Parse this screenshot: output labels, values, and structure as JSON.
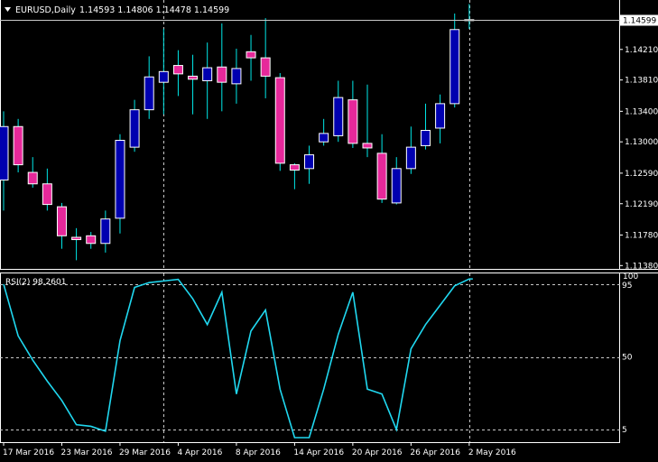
{
  "header": {
    "symbol_label": "EURUSD,Daily",
    "ohlc_label": "1.14593 1.14806 1.14478 1.14599",
    "menu_icon": "triangle-down-icon"
  },
  "rsi": {
    "label": "RSI(2) 98.2601",
    "value": 98.2601,
    "levels": [
      95,
      50,
      5
    ],
    "max_label": "100"
  },
  "current_price_label": "1.14599",
  "colors": {
    "background": "#000000",
    "bull_body": "#0000b0",
    "bear_body": "#e6289a",
    "wick": "#00e8e8",
    "candle_outline": "#ffffff",
    "rsi_line": "#20d8f0",
    "grid": "#c8c8c8",
    "price_line": "#c8c8c8"
  },
  "chart_data": [
    {
      "type": "candlestick",
      "title": "EURUSD,Daily",
      "price_ticks": [
        "1.14210",
        "1.13810",
        "1.13400",
        "1.13000",
        "1.12590",
        "1.12190",
        "1.11780",
        "1.11380"
      ],
      "price_range": [
        1.1136,
        1.1481
      ],
      "date_ticks": [
        "17 Mar 2016",
        "23 Mar 2016",
        "29 Mar 2016",
        "4 Apr 2016",
        "8 Apr 2016",
        "14 Apr 2016",
        "20 Apr 2016",
        "26 Apr 2016",
        "2 May 2016"
      ],
      "candles": [
        {
          "o": 1.125,
          "h": 1.134,
          "l": 1.121,
          "c": 1.132
        },
        {
          "o": 1.132,
          "h": 1.133,
          "l": 1.126,
          "c": 1.127
        },
        {
          "o": 1.126,
          "h": 1.128,
          "l": 1.124,
          "c": 1.1245
        },
        {
          "o": 1.1245,
          "h": 1.1265,
          "l": 1.121,
          "c": 1.1218
        },
        {
          "o": 1.1215,
          "h": 1.122,
          "l": 1.116,
          "c": 1.1177
        },
        {
          "o": 1.1175,
          "h": 1.1187,
          "l": 1.1145,
          "c": 1.1172
        },
        {
          "o": 1.1177,
          "h": 1.1182,
          "l": 1.116,
          "c": 1.1167
        },
        {
          "o": 1.1167,
          "h": 1.121,
          "l": 1.1155,
          "c": 1.1199
        },
        {
          "o": 1.12,
          "h": 1.131,
          "l": 1.118,
          "c": 1.1302
        },
        {
          "o": 1.1293,
          "h": 1.1355,
          "l": 1.1287,
          "c": 1.1342
        },
        {
          "o": 1.1342,
          "h": 1.1412,
          "l": 1.133,
          "c": 1.1385
        },
        {
          "o": 1.1378,
          "h": 1.1448,
          "l": 1.1336,
          "c": 1.1392
        },
        {
          "o": 1.14,
          "h": 1.142,
          "l": 1.136,
          "c": 1.1389
        },
        {
          "o": 1.1386,
          "h": 1.1414,
          "l": 1.1336,
          "c": 1.1382
        },
        {
          "o": 1.138,
          "h": 1.143,
          "l": 1.133,
          "c": 1.1397
        },
        {
          "o": 1.1398,
          "h": 1.1455,
          "l": 1.134,
          "c": 1.1378
        },
        {
          "o": 1.1376,
          "h": 1.1422,
          "l": 1.135,
          "c": 1.1396
        },
        {
          "o": 1.1418,
          "h": 1.144,
          "l": 1.138,
          "c": 1.141
        },
        {
          "o": 1.141,
          "h": 1.1462,
          "l": 1.1357,
          "c": 1.1386
        },
        {
          "o": 1.1384,
          "h": 1.139,
          "l": 1.1262,
          "c": 1.1272
        },
        {
          "o": 1.127,
          "h": 1.1272,
          "l": 1.1238,
          "c": 1.1263
        },
        {
          "o": 1.1265,
          "h": 1.1295,
          "l": 1.1245,
          "c": 1.1283
        },
        {
          "o": 1.13,
          "h": 1.133,
          "l": 1.1295,
          "c": 1.1311
        },
        {
          "o": 1.1308,
          "h": 1.138,
          "l": 1.13,
          "c": 1.1358
        },
        {
          "o": 1.1355,
          "h": 1.138,
          "l": 1.1292,
          "c": 1.1298
        },
        {
          "o": 1.1298,
          "h": 1.1375,
          "l": 1.128,
          "c": 1.1292
        },
        {
          "o": 1.1285,
          "h": 1.131,
          "l": 1.122,
          "c": 1.1225
        },
        {
          "o": 1.122,
          "h": 1.128,
          "l": 1.1218,
          "c": 1.1265
        },
        {
          "o": 1.1265,
          "h": 1.132,
          "l": 1.1258,
          "c": 1.1293
        },
        {
          "o": 1.1295,
          "h": 1.135,
          "l": 1.129,
          "c": 1.1315
        },
        {
          "o": 1.1318,
          "h": 1.1362,
          "l": 1.1298,
          "c": 1.135
        },
        {
          "o": 1.135,
          "h": 1.1468,
          "l": 1.1345,
          "c": 1.1447
        },
        {
          "o": 1.14593,
          "h": 1.14806,
          "l": 1.14478,
          "c": 1.14599
        }
      ]
    },
    {
      "type": "line",
      "title": "RSI(2) 98.2601",
      "ylim": [
        0,
        100
      ],
      "y_ticks": [
        "100",
        "95",
        "50",
        "5"
      ],
      "values": [
        95,
        63,
        48,
        35,
        23,
        8,
        7,
        4,
        60,
        93,
        96,
        97,
        98,
        86,
        70,
        90,
        27,
        66,
        79,
        30,
        0,
        0,
        30,
        64,
        90,
        30,
        27,
        5,
        55,
        70,
        82,
        94,
        98.2601
      ]
    }
  ]
}
